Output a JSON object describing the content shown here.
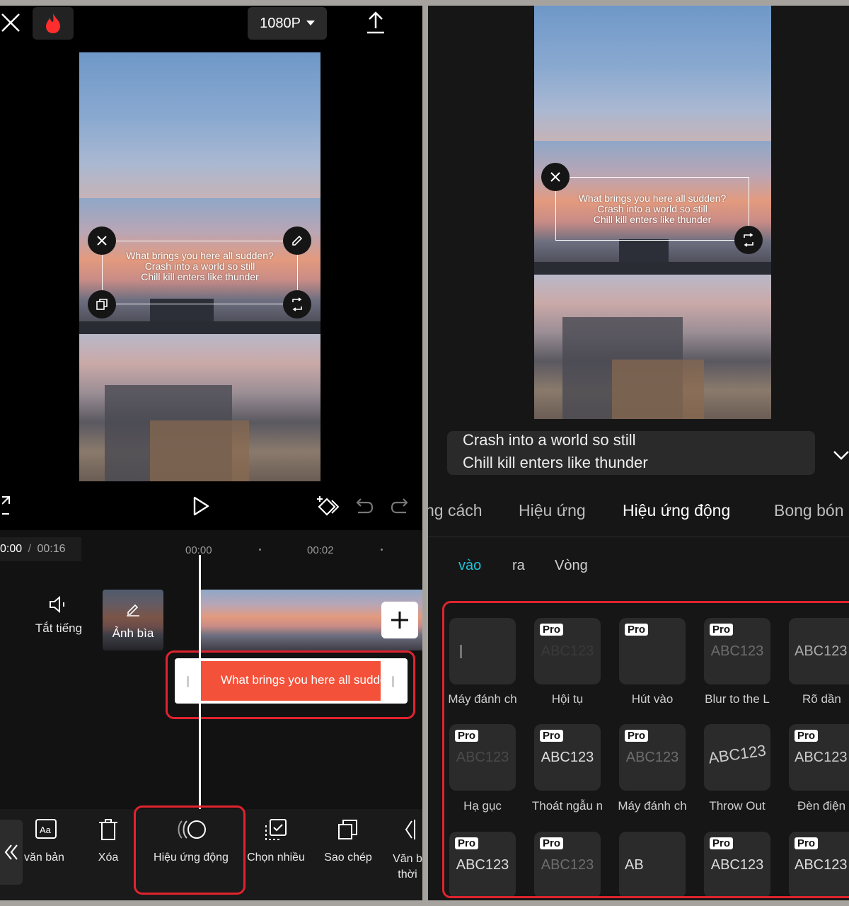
{
  "colors": {
    "accent": "#1fc4d8",
    "highlight": "#e0232e",
    "clip": "#f4513a"
  },
  "left": {
    "resolution_label": "1080P",
    "caption_lines": [
      "What brings you here all sudden?",
      "Crash into a world so still",
      "Chill kill enters like thunder"
    ],
    "time_current": "0:00",
    "time_separator": "/",
    "time_total": "00:16",
    "ruler_marks": [
      "00:00",
      "00:02"
    ],
    "mute_label": "Tắt tiếng",
    "cover_label": "Ảnh bìa",
    "text_clip_label": "What brings you here all sudden",
    "toolbar": [
      {
        "label": "văn bản",
        "icon": "text-style-icon"
      },
      {
        "label": "Xóa",
        "icon": "delete-icon"
      },
      {
        "label": "Hiệu ứng động",
        "icon": "animation-icon"
      },
      {
        "label": "Chọn nhiều",
        "icon": "multi-select-icon"
      },
      {
        "label": "Sao chép",
        "icon": "copy-icon"
      },
      {
        "label": "Văn b thời",
        "icon": "text-timing-icon"
      }
    ]
  },
  "right": {
    "caption_lines": [
      "What brings you here all sudden?",
      "Crash into a world so still",
      "Chill kill enters like thunder"
    ],
    "text_input_lines": [
      "Crash into a world so still",
      "Chill kill enters like thunder"
    ],
    "tabs": [
      "ng cách",
      "Hiệu ứng",
      "Hiệu ứng động",
      "Bong bón"
    ],
    "active_tab": "Hiệu ứng động",
    "subtabs": [
      "vào",
      "ra",
      "Vòng"
    ],
    "active_subtab": "vào",
    "pro_badge": "Pro",
    "effects": [
      {
        "label": "Máy đánh ch",
        "pro": false,
        "preview": "|"
      },
      {
        "label": "Hội tụ",
        "pro": true,
        "preview": "ABC123"
      },
      {
        "label": "Hút vào",
        "pro": true,
        "preview": ""
      },
      {
        "label": "Blur to the L",
        "pro": true,
        "preview": "ABC123"
      },
      {
        "label": "Rõ dần",
        "pro": false,
        "preview": "ABC123"
      },
      {
        "label": "Hạ gục",
        "pro": true,
        "preview": "ABC123"
      },
      {
        "label": "Thoát ngẫu n",
        "pro": true,
        "preview": "ABC123"
      },
      {
        "label": "Máy đánh ch",
        "pro": true,
        "preview": "ABC123"
      },
      {
        "label": "Throw Out",
        "pro": false,
        "preview": "ABC123"
      },
      {
        "label": "Đèn điện",
        "pro": true,
        "preview": "ABC123"
      },
      {
        "label": "",
        "pro": true,
        "preview": "ABC123"
      },
      {
        "label": "",
        "pro": true,
        "preview": "ABC123"
      },
      {
        "label": "",
        "pro": false,
        "preview": "AB"
      },
      {
        "label": "",
        "pro": true,
        "preview": "ABC123"
      },
      {
        "label": "",
        "pro": true,
        "preview": "ABC123"
      }
    ]
  }
}
